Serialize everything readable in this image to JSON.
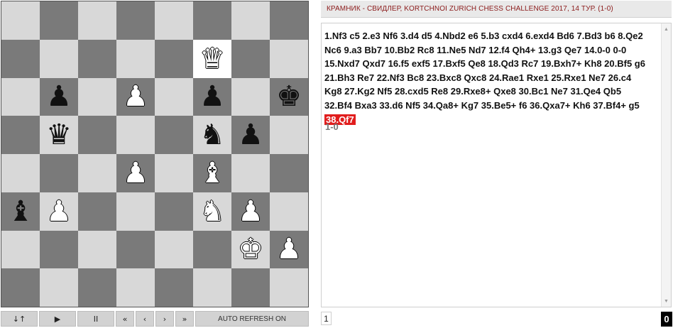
{
  "game": {
    "title": "КРАМНИК - СВИДЛЕР, KORTCHNOI ZURICH CHESS CHALLENGE 2017, 14 ТУР. (1-0)",
    "moves_before_current": "1.Nf3 c5 2.e3 Nf6 3.d4 d5 4.Nbd2 e6 5.b3 cxd4 6.exd4 Bd6 7.Bd3 b6 8.Qe2 Nc6 9.a3 Bb7 10.Bb2 Rc8 11.Ne5 Nd7 12.f4 Qh4+ 13.g3 Qe7 14.0-0 0-0 15.Nxd7 Qxd7 16.f5 exf5 17.Bxf5 Qe8 18.Qd3 Rc7 19.Bxh7+ Kh8 20.Bf5 g6 21.Bh3 Re7 22.Nf3 Bc8 23.Bxc8 Qxc8 24.Rae1 Rxe1 25.Rxe1 Ne7 26.c4 Kg8 27.Kg2 Nf5 28.cxd5 Re8 29.Rxe8+ Qxe8 30.Bc1 Ne7 31.Qe4 Qb5 32.Bf4 Bxa3 33.d6 Nf5 34.Qa8+ Kg7 35.Be5+ f6 36.Qxa7+ Kh6 37.Bf4+ g5",
    "current_move": "38.Qf7",
    "result": "1-0"
  },
  "board": {
    "ranks": [
      [
        null,
        null,
        null,
        null,
        null,
        null,
        null,
        null
      ],
      [
        null,
        null,
        null,
        null,
        null,
        "wQ",
        null,
        null
      ],
      [
        null,
        "bP",
        null,
        "wP",
        null,
        "bP",
        null,
        "bK"
      ],
      [
        null,
        "bQ",
        null,
        null,
        null,
        "bN",
        "bP",
        null
      ],
      [
        null,
        null,
        null,
        "wP",
        null,
        "wB",
        null,
        null
      ],
      [
        "bB",
        "wP",
        null,
        null,
        null,
        "wN",
        "wP",
        null
      ],
      [
        null,
        null,
        null,
        null,
        null,
        null,
        "wK",
        "wP"
      ],
      [
        null,
        null,
        null,
        null,
        null,
        null,
        null,
        null
      ]
    ],
    "highlighted": [
      [
        1,
        5
      ]
    ],
    "colors": {
      "light": "#d8d8d8",
      "dark": "#7a7a7a",
      "highlight": "#ffffff"
    }
  },
  "controls": {
    "flip_icon": "flip-board-icon",
    "flip_label": "↓↑",
    "play_label": "▶",
    "pause_label": "II",
    "first_label": "«",
    "prev_label": "‹",
    "next_label": "›",
    "last_label": "»",
    "auto_refresh_label": "AUTO REFRESH ON"
  },
  "footer": {
    "page_number": "1",
    "count": "0"
  },
  "theme": {
    "title_color": "#8b1a1a",
    "current_move_bg": "#e11d1d"
  }
}
